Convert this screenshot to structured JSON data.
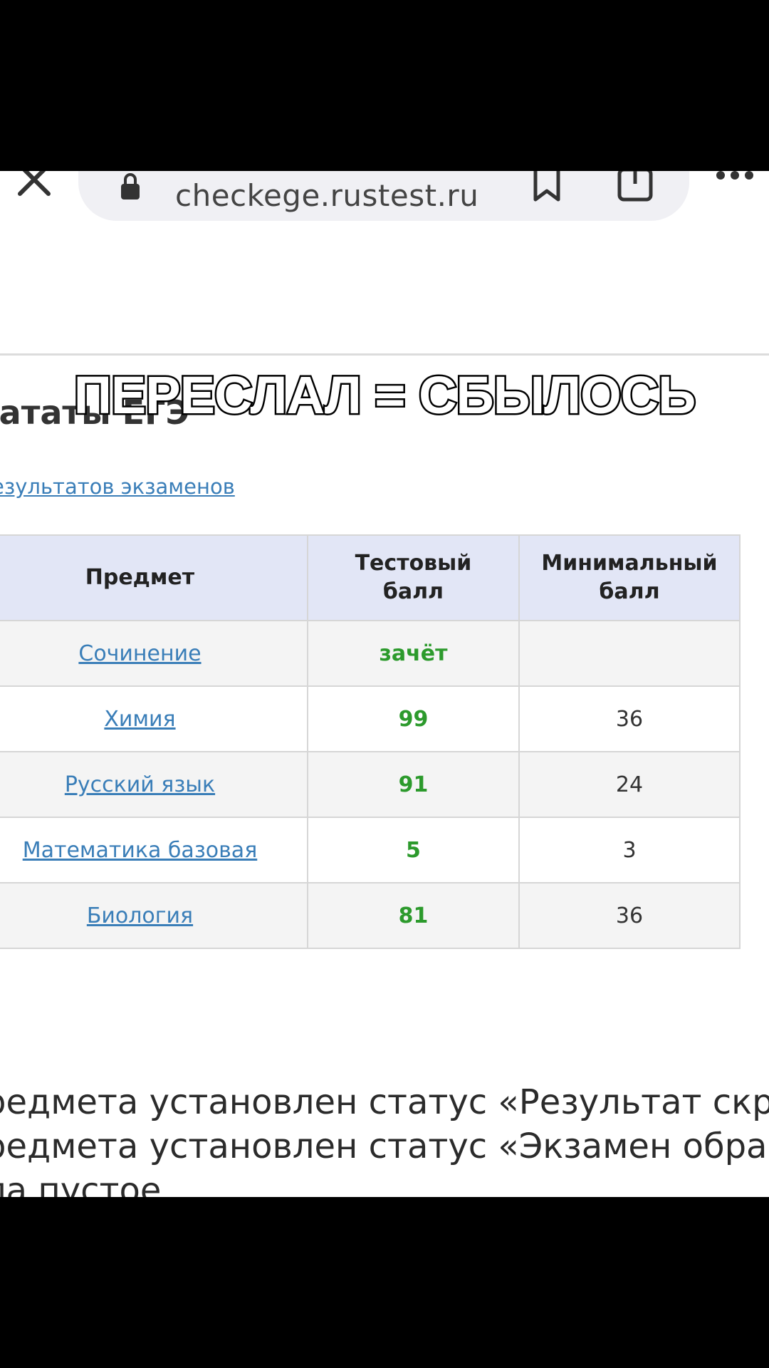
{
  "browser": {
    "url": "checkege.rustest.ru"
  },
  "overlay_caption": "ПЕРЕСЛАЛ = СБЫЛОСЬ",
  "page": {
    "heading": "тататы ЕГЭ",
    "results_link": "езультатов экзаменов"
  },
  "table": {
    "headers": {
      "subject": "Предмет",
      "score_line1": "Тестовый",
      "score_line2": "балл",
      "min_line1": "Минимальный",
      "min_line2": "балл"
    },
    "rows": [
      {
        "subject": "Сочинение",
        "score": "зачёт",
        "min": ""
      },
      {
        "subject": "Химия",
        "score": "99",
        "min": "36"
      },
      {
        "subject": "Русский язык",
        "score": "91",
        "min": "24"
      },
      {
        "subject": "Математика базовая",
        "score": "5",
        "min": "3"
      },
      {
        "subject": "Биология",
        "score": "81",
        "min": "36"
      }
    ]
  },
  "notes": {
    "line0": ":",
    "line1": "редмета установлен статус «Результат скрыт»",
    "line2": "редмета установлен статус «Экзамен обработа",
    "line3": "ла пустое"
  },
  "colors": {
    "link": "#3a7eb8",
    "score_green": "#2c9a2c",
    "header_bg": "#e2e6f6"
  }
}
